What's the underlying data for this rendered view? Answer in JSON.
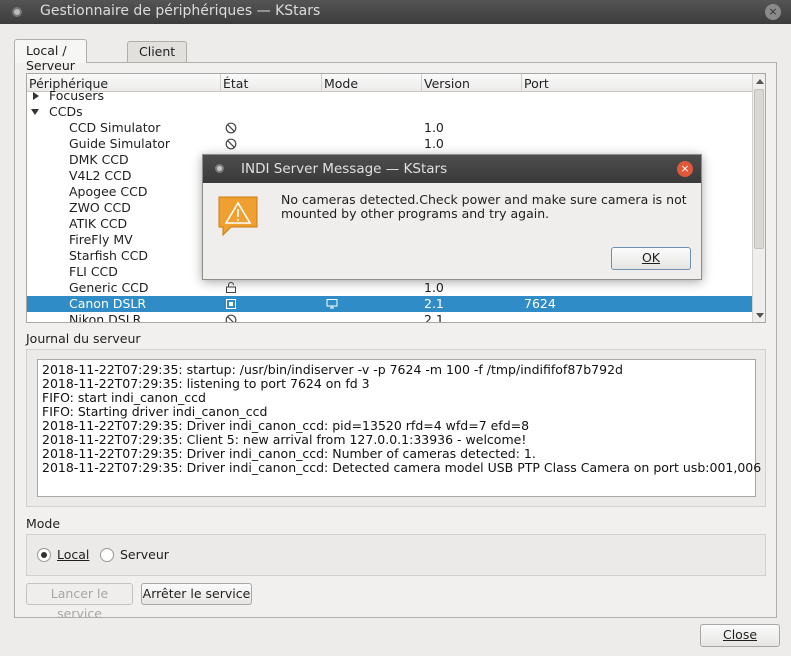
{
  "window": {
    "title": "Gestionnaire de périphériques — KStars",
    "close_glyph": "×"
  },
  "tabs": [
    {
      "label": "Local / Serveur",
      "active": true
    },
    {
      "label": "Client",
      "active": false
    }
  ],
  "tree": {
    "columns": [
      "Périphérique",
      "État",
      "Mode",
      "Version",
      "Port"
    ],
    "rows": [
      {
        "name": "Focusers",
        "level": 0,
        "expander": "collapsed",
        "state_icon": "",
        "mode_icon": "",
        "version": "",
        "port": ""
      },
      {
        "name": "CCDs",
        "level": 0,
        "expander": "expanded",
        "state_icon": "",
        "mode_icon": "",
        "version": "",
        "port": ""
      },
      {
        "name": "CCD Simulator",
        "level": 1,
        "state_icon": "stopped-icon",
        "mode_icon": "",
        "version": "1.0",
        "port": ""
      },
      {
        "name": "Guide Simulator",
        "level": 1,
        "state_icon": "stopped-icon",
        "mode_icon": "",
        "version": "1.0",
        "port": ""
      },
      {
        "name": "DMK CCD",
        "level": 1,
        "state_icon": "",
        "mode_icon": "",
        "version": "",
        "port": ""
      },
      {
        "name": "V4L2 CCD",
        "level": 1,
        "state_icon": "",
        "mode_icon": "",
        "version": "",
        "port": ""
      },
      {
        "name": "Apogee CCD",
        "level": 1,
        "state_icon": "",
        "mode_icon": "",
        "version": "",
        "port": ""
      },
      {
        "name": "ZWO CCD",
        "level": 1,
        "state_icon": "",
        "mode_icon": "",
        "version": "",
        "port": ""
      },
      {
        "name": "ATIK CCD",
        "level": 1,
        "state_icon": "",
        "mode_icon": "",
        "version": "",
        "port": ""
      },
      {
        "name": "FireFly MV",
        "level": 1,
        "state_icon": "",
        "mode_icon": "",
        "version": "",
        "port": ""
      },
      {
        "name": "Starfish CCD",
        "level": 1,
        "state_icon": "",
        "mode_icon": "",
        "version": "",
        "port": ""
      },
      {
        "name": "FLI CCD",
        "level": 1,
        "state_icon": "",
        "mode_icon": "",
        "version": "",
        "port": ""
      },
      {
        "name": "Generic CCD",
        "level": 1,
        "state_icon": "idle-icon",
        "mode_icon": "",
        "version": "1.0",
        "port": ""
      },
      {
        "name": "Canon DSLR",
        "level": 1,
        "state_icon": "running-icon",
        "mode_icon": "monitor-icon",
        "version": "2.1",
        "port": "7624",
        "selected": true
      },
      {
        "name": "Nikon DSLR",
        "level": 1,
        "state_icon": "stopped-icon",
        "mode_icon": "",
        "version": "2.1",
        "port": ""
      }
    ]
  },
  "journal": {
    "label": "Journal du serveur",
    "lines": [
      "2018-11-22T07:29:35: startup: /usr/bin/indiserver -v -p 7624 -m 100 -f /tmp/indififof87b792d",
      "2018-11-22T07:29:35: listening to port 7624 on fd 3",
      "FIFO: start indi_canon_ccd",
      "FIFO: Starting driver indi_canon_ccd",
      "2018-11-22T07:29:35: Driver indi_canon_ccd: pid=13520 rfd=4 wfd=7 efd=8",
      "2018-11-22T07:29:35: Client 5: new arrival from 127.0.0.1:33936 - welcome!",
      "2018-11-22T07:29:35: Driver indi_canon_ccd: Number of cameras detected: 1.",
      "2018-11-22T07:29:35: Driver indi_canon_ccd: Detected camera model USB PTP Class Camera on port usb:001,006"
    ]
  },
  "mode": {
    "label": "Mode",
    "options": [
      {
        "label": "Local",
        "checked": true
      },
      {
        "label": "Serveur",
        "checked": false
      }
    ]
  },
  "buttons": {
    "start": "Lancer le service",
    "stop": "Arrêter le service",
    "close": "Close"
  },
  "dialog": {
    "title": "INDI Server Message — KStars",
    "close_glyph": "×",
    "message": "No cameras detected.Check power and make sure camera is not mounted by other programs and try again.",
    "ok": "OK"
  },
  "colors": {
    "selection": "#308cc6",
    "dialog_close": "#e0583a",
    "warning": "#f0a030"
  }
}
